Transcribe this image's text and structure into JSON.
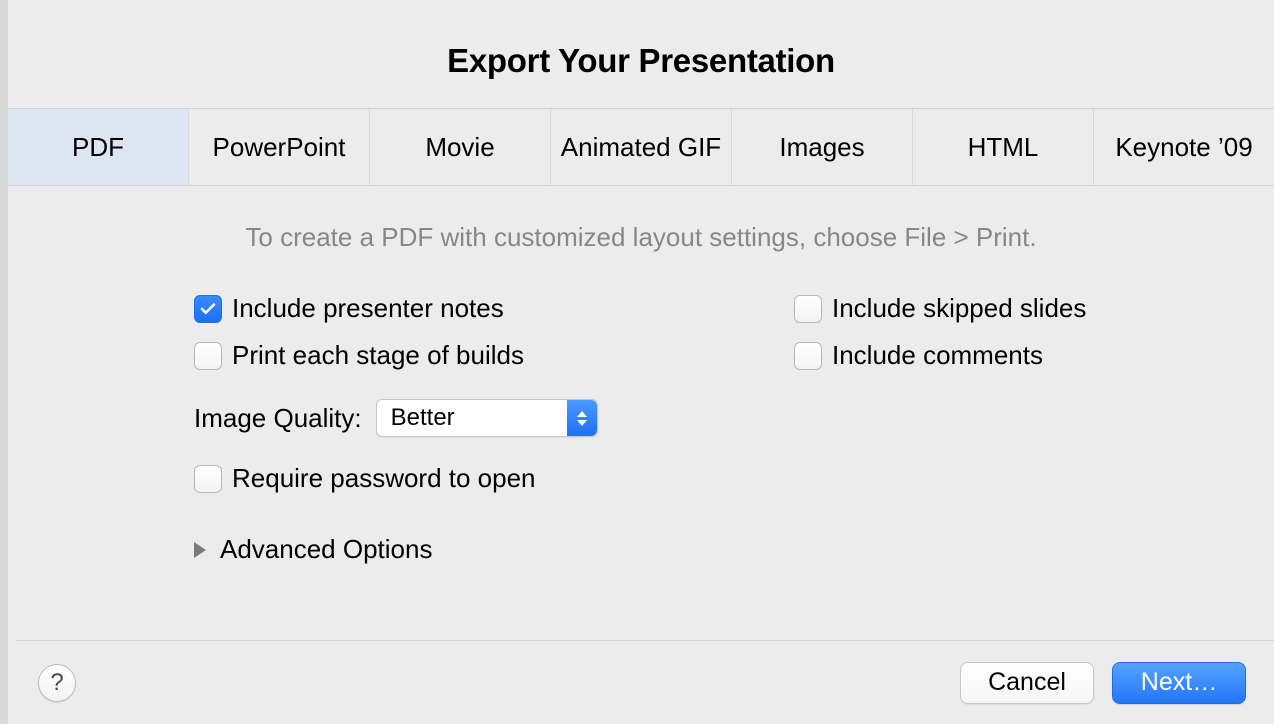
{
  "title": "Export Your Presentation",
  "tabs": [
    {
      "label": "PDF",
      "active": true
    },
    {
      "label": "PowerPoint",
      "active": false
    },
    {
      "label": "Movie",
      "active": false
    },
    {
      "label": "Animated GIF",
      "active": false
    },
    {
      "label": "Images",
      "active": false
    },
    {
      "label": "HTML",
      "active": false
    },
    {
      "label": "Keynote ’09",
      "active": false
    }
  ],
  "hint": "To create a PDF with customized layout settings, choose File > Print.",
  "options": {
    "include_presenter_notes": {
      "label": "Include presenter notes",
      "checked": true
    },
    "include_skipped_slides": {
      "label": "Include skipped slides",
      "checked": false
    },
    "print_each_stage": {
      "label": "Print each stage of builds",
      "checked": false
    },
    "include_comments": {
      "label": "Include comments",
      "checked": false
    },
    "image_quality": {
      "label": "Image Quality:",
      "value": "Better"
    },
    "require_password": {
      "label": "Require password to open",
      "checked": false
    },
    "advanced": {
      "label": "Advanced Options"
    }
  },
  "footer": {
    "help": "?",
    "cancel": "Cancel",
    "next": "Next…"
  }
}
